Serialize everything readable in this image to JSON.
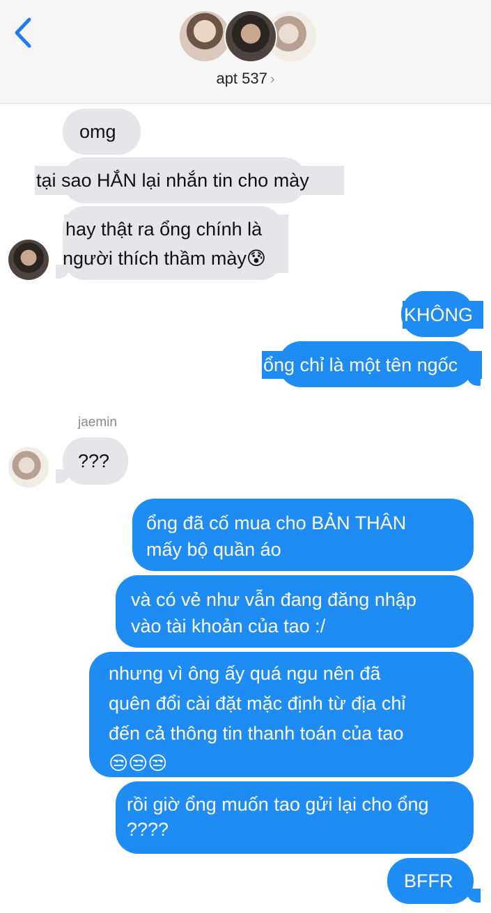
{
  "header": {
    "back_icon": "chevron-left-icon",
    "chat_name": "apt 537",
    "chevron": "›"
  },
  "messages": {
    "m1": "omg",
    "m2": "tại sao HẮN lại nhắn tin cho mày",
    "m3_line1": "hay thật ra ổng chính là",
    "m3_line2": "người thích thầm mày😰",
    "m4": "KHÔNG",
    "m5": "ổng chỉ là một tên ngốc",
    "sender_jaemin": "jaemin",
    "m6": "???",
    "m7_line1": "ổng đã cố mua cho BẢN THÂN",
    "m7_line2": "mấy bộ quần áo",
    "m8_line1": "và có vẻ như vẫn đang đăng nhập",
    "m8_line2": "vào tài khoản của tao :/",
    "m9_line1": "nhưng vì ông ấy quá ngu nên đã",
    "m9_line2": "quên đổi cài đặt mặc định từ địa chỉ",
    "m9_line3": "đến cả thông tin thanh toán của tao",
    "m9_line4": "😒😒😒",
    "m10_line1": "rồi giờ ổng muốn tao gửi lại cho ổng",
    "m10_line2": "????",
    "m11": "BFFR"
  },
  "colors": {
    "incoming": "#e6e5ea",
    "outgoing": "#1e8cf3",
    "accent": "#1e7cf2"
  }
}
